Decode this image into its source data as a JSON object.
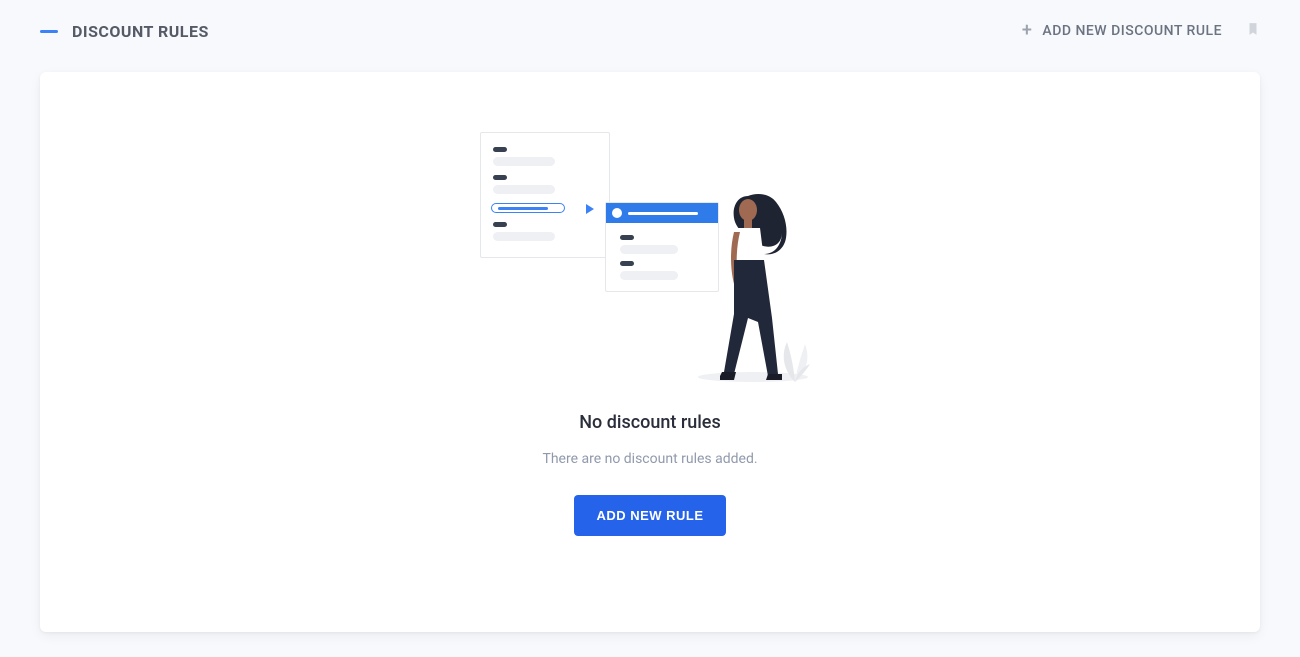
{
  "header": {
    "title": "DISCOUNT RULES",
    "add_button_label": "ADD NEW DISCOUNT RULE"
  },
  "empty_state": {
    "title": "No discount rules",
    "subtitle": "There are no discount rules added.",
    "button_label": "ADD NEW RULE"
  },
  "colors": {
    "accent": "#2563eb",
    "text_primary": "#2a2e3a",
    "text_muted": "#9099ac"
  }
}
